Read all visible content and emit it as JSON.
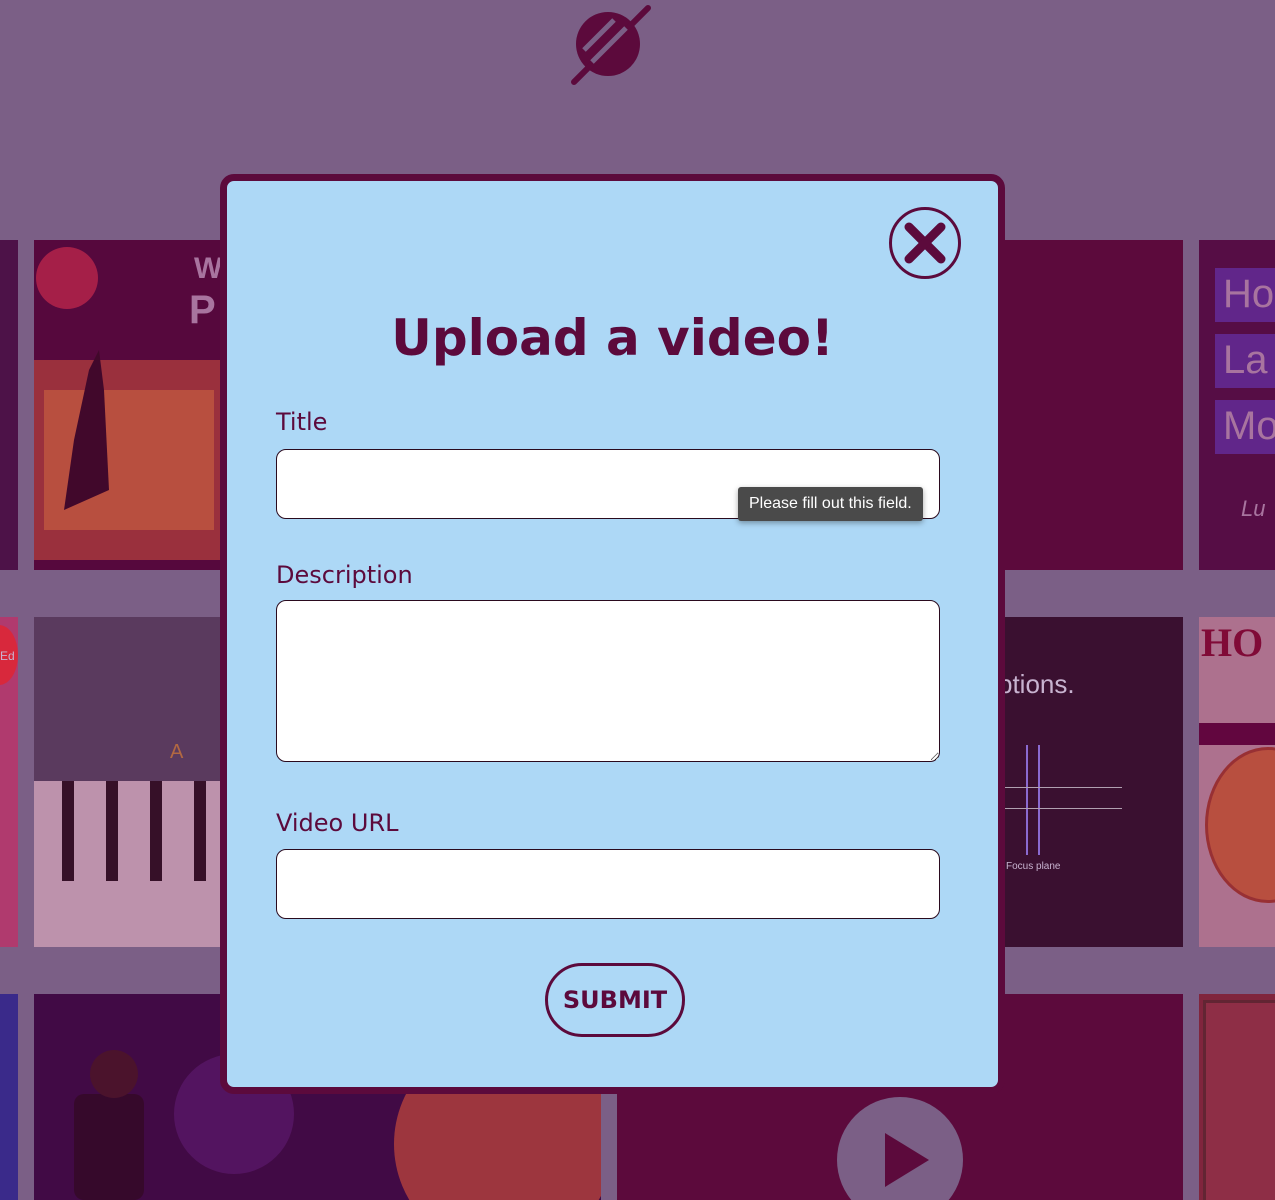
{
  "header": {
    "logo_icon": "slashed-circle-logo-icon"
  },
  "background_tiles": {
    "overlay_color": "#6c0046",
    "text_fragments": [
      "W",
      "P",
      "Ho",
      "La",
      "Mo",
      "Lu",
      "Ed",
      "A",
      "ptions.",
      "Focus plane",
      "HO"
    ]
  },
  "modal": {
    "title": "Upload a video!",
    "close_icon": "close-x-icon",
    "fields": {
      "title": {
        "label": "Title",
        "value": ""
      },
      "description": {
        "label": "Description",
        "value": ""
      },
      "video_url": {
        "label": "Video URL",
        "value": ""
      }
    },
    "validation_tooltip": "Please fill out this field.",
    "submit_label": "SUBMIT"
  },
  "colors": {
    "page_background": "#7b5f86",
    "modal_background": "#add8f6",
    "accent": "#5c0a3c",
    "tooltip_background": "#4a4a4a"
  }
}
